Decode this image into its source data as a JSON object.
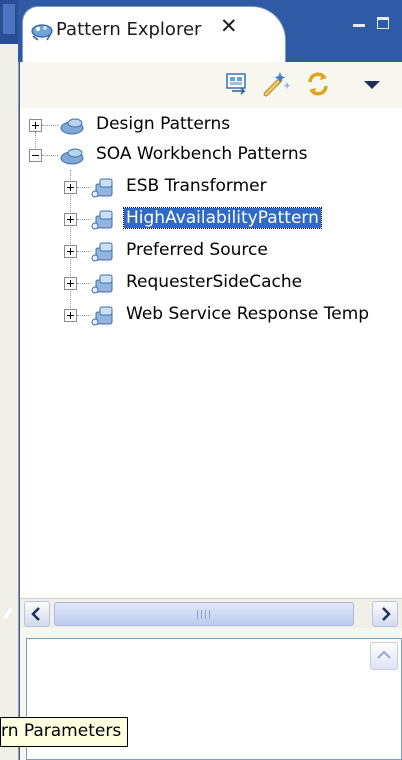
{
  "view_tab": {
    "title": "Pattern Explorer",
    "close_glyph": "✕"
  },
  "toolbar": {
    "buttons": [
      {
        "name": "select-in-view-icon"
      },
      {
        "name": "apply-pattern-icon"
      },
      {
        "name": "sync-icon"
      },
      {
        "name": "view-menu-icon"
      }
    ]
  },
  "tree": {
    "nodes": [
      {
        "label": "Design Patterns",
        "expanded": false,
        "level": 0
      },
      {
        "label": "SOA Workbench Patterns",
        "expanded": true,
        "level": 0
      },
      {
        "label": "ESB Transformer",
        "expanded": false,
        "level": 1
      },
      {
        "label": "HighAvailabilityPattern",
        "expanded": false,
        "level": 1,
        "selected": true
      },
      {
        "label": "Preferred Source",
        "expanded": false,
        "level": 1
      },
      {
        "label": "RequesterSideCache",
        "expanded": false,
        "level": 1
      },
      {
        "label": "Web Service Response Temp",
        "expanded": false,
        "level": 1
      }
    ]
  },
  "tooltip": {
    "text": "rn Parameters"
  },
  "colors": {
    "selection": "#316ac5",
    "title_bar": "#2f5aa6"
  }
}
